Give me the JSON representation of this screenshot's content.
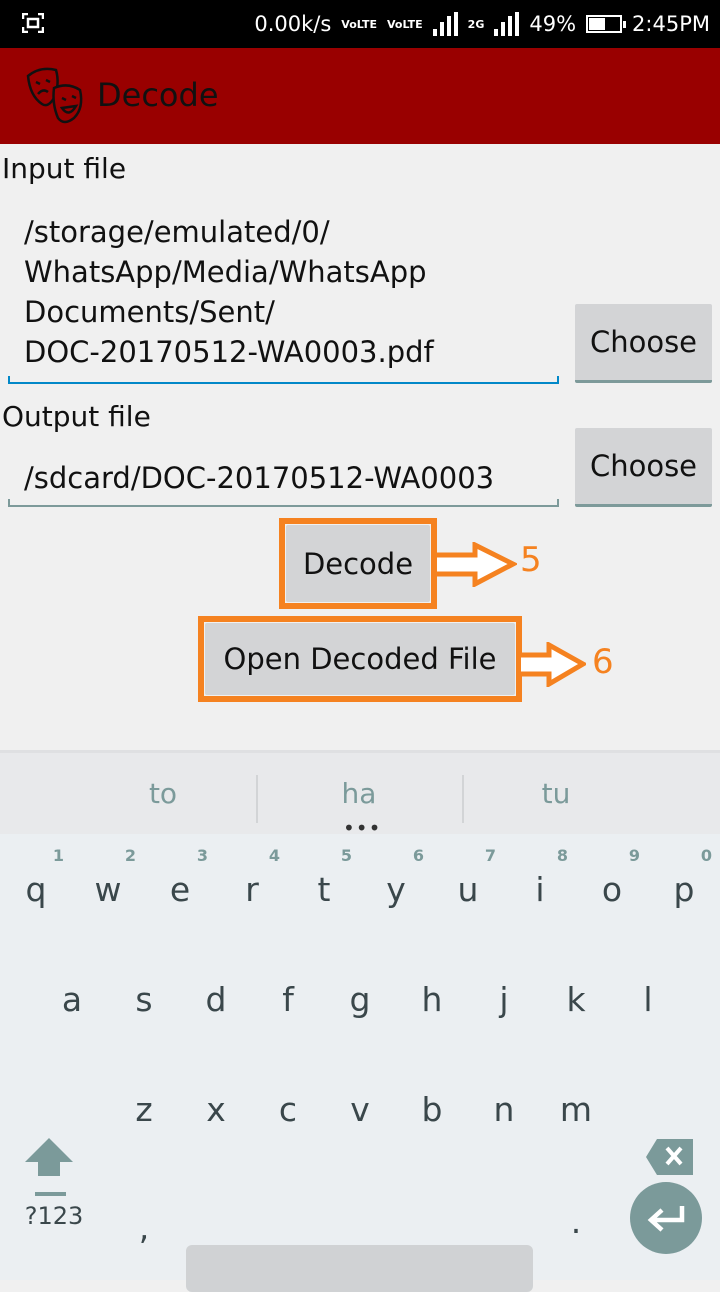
{
  "statusbar": {
    "screenshot_icon": "screenshot-icon",
    "net_speed": "0.00k/s",
    "volte1": "VoLTE",
    "volte2": "VoLTE",
    "network2": "2G",
    "battery_percent_text": "49%",
    "battery_level": 0.49,
    "time": "2:45PM"
  },
  "appbar": {
    "logo": "theater-masks-icon",
    "title": "Decode",
    "color": "#990000"
  },
  "form": {
    "input_label": "Input file",
    "input_value_lines": [
      "/storage/emulated/0/",
      "WhatsApp/Media/WhatsApp",
      "Documents/Sent/",
      "DOC-20170512-WA0003.pdf"
    ],
    "input_choose": "Choose",
    "output_label": "Output file",
    "output_value": "/sdcard/DOC-20170512-WA0003",
    "output_choose": "Choose",
    "decode_button": "Decode",
    "open_button": "Open Decoded File",
    "focus_color": "#0288c8"
  },
  "annotations": {
    "step5": "5",
    "step6": "6",
    "color": "#f58220"
  },
  "keyboard": {
    "suggestions": [
      "to",
      "ha",
      "tu"
    ],
    "more_suggestions": "•••",
    "row1": [
      "q",
      "w",
      "e",
      "r",
      "t",
      "y",
      "u",
      "i",
      "o",
      "p"
    ],
    "row1_hints": [
      "1",
      "2",
      "3",
      "4",
      "5",
      "6",
      "7",
      "8",
      "9",
      "0"
    ],
    "row2": [
      "a",
      "s",
      "d",
      "f",
      "g",
      "h",
      "j",
      "k",
      "l"
    ],
    "row3": [
      "z",
      "x",
      "c",
      "v",
      "b",
      "n",
      "m"
    ],
    "symbols_key": "?123",
    "comma": ",",
    "period": "."
  }
}
